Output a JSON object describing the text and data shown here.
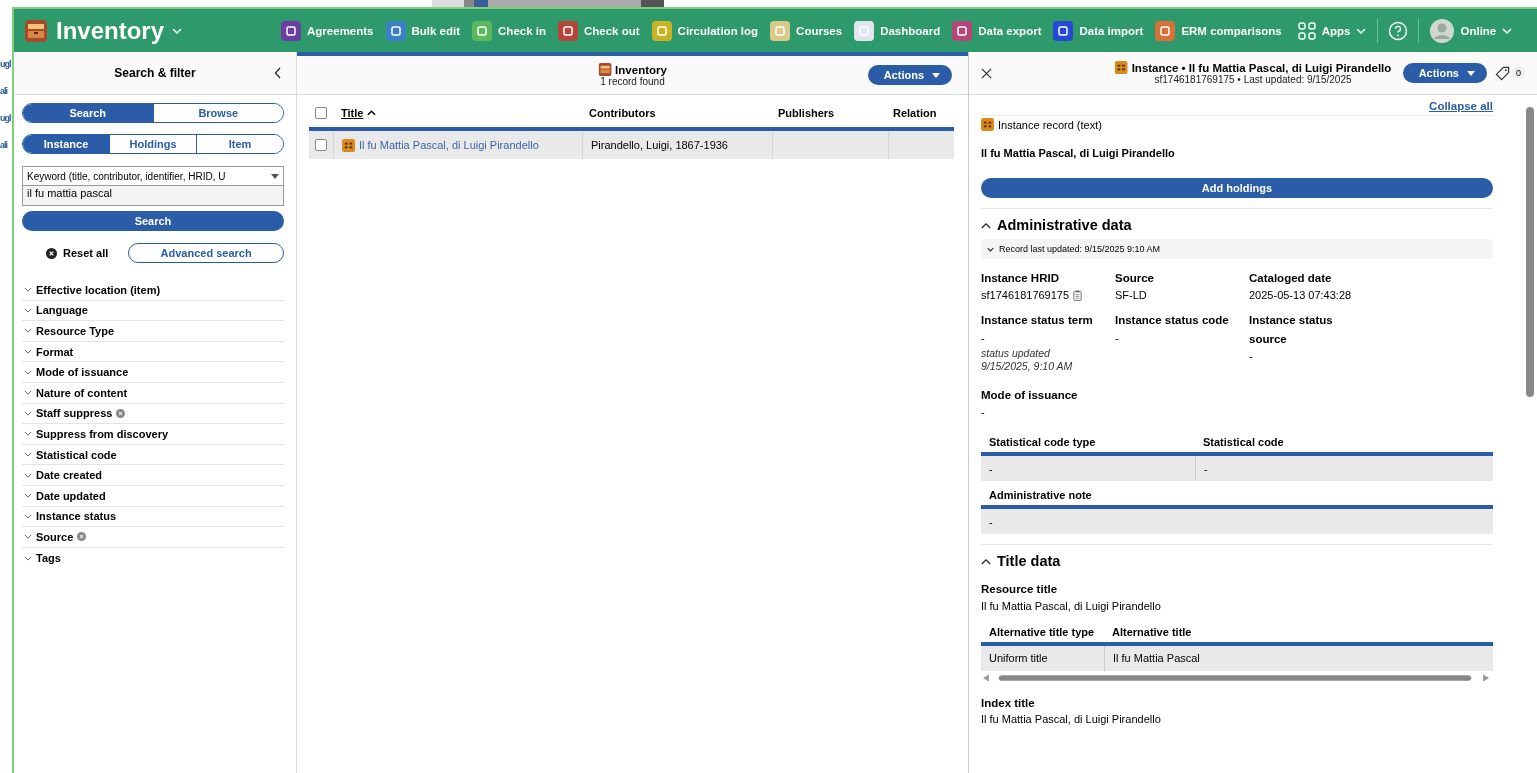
{
  "background_window": {
    "fragments": [
      "ugl",
      "ali",
      "ugl",
      "ali"
    ]
  },
  "app_header": {
    "app_name": "Inventory",
    "apps": [
      {
        "label": "Agreements",
        "color": "#6b3fa0"
      },
      {
        "label": "Bulk edit",
        "color": "#3b7fc4"
      },
      {
        "label": "Check in",
        "color": "#5cb85c"
      },
      {
        "label": "Check out",
        "color": "#b5473a"
      },
      {
        "label": "Circulation log",
        "color": "#c9b325"
      },
      {
        "label": "Courses",
        "color": "#d9c98a"
      },
      {
        "label": "Dashboard",
        "color": "#dfe6ee"
      },
      {
        "label": "Data export",
        "color": "#b8457a"
      },
      {
        "label": "Data import",
        "color": "#2748d6"
      },
      {
        "label": "ERM comparisons",
        "color": "#d9703a"
      }
    ],
    "apps_menu": "Apps",
    "user_status": "Online"
  },
  "filter_pane": {
    "title": "Search & filter",
    "segments": [
      {
        "label": "Search",
        "selected": true
      },
      {
        "label": "Browse",
        "selected": false
      }
    ],
    "record_types": [
      {
        "label": "Instance",
        "selected": true
      },
      {
        "label": "Holdings",
        "selected": false
      },
      {
        "label": "Item",
        "selected": false
      }
    ],
    "search_option": "Keyword (title, contributor, identifier, HRID, U",
    "query": "il fu mattia pascal",
    "search_button": "Search",
    "reset_all": "Reset all",
    "advanced_search": "Advanced search",
    "filters": [
      {
        "label": "Effective location (item)",
        "expanded": false,
        "clearable": false
      },
      {
        "label": "Language",
        "expanded": false,
        "clearable": false
      },
      {
        "label": "Resource Type",
        "expanded": false,
        "clearable": false
      },
      {
        "label": "Format",
        "expanded": false,
        "clearable": false
      },
      {
        "label": "Mode of issuance",
        "expanded": false,
        "clearable": false
      },
      {
        "label": "Nature of content",
        "expanded": false,
        "clearable": false
      },
      {
        "label": "Staff suppress",
        "expanded": false,
        "clearable": true
      },
      {
        "label": "Suppress from discovery",
        "expanded": false,
        "clearable": false
      },
      {
        "label": "Statistical code",
        "expanded": false,
        "clearable": false
      },
      {
        "label": "Date created",
        "expanded": false,
        "clearable": false
      },
      {
        "label": "Date updated",
        "expanded": false,
        "clearable": false
      },
      {
        "label": "Instance status",
        "expanded": false,
        "clearable": false
      },
      {
        "label": "Source",
        "expanded": false,
        "clearable": true
      },
      {
        "label": "Tags",
        "expanded": false,
        "clearable": false
      }
    ]
  },
  "results_pane": {
    "title": "Inventory",
    "subtitle": "1 record found",
    "actions": "Actions",
    "select_all": {
      "checked": false
    },
    "columns": [
      {
        "label": "Title",
        "sorted": true
      },
      {
        "label": "Contributors",
        "sorted": false
      },
      {
        "label": "Publishers",
        "sorted": false
      },
      {
        "label": "Relation",
        "sorted": false
      }
    ],
    "rows": [
      {
        "selected": true,
        "checked": false,
        "title": "Il fu Mattia Pascal, di Luigi Pirandello",
        "contributors": "Pirandello, Luigi, 1867-1936"
      }
    ]
  },
  "detail_pane": {
    "title": "Instance • Il fu Mattia Pascal, di Luigi Pirandello",
    "subtitle": "sf1746181769175 • Last updated: 9/15/2025",
    "actions": "Actions",
    "tag_count": "0",
    "collapse_all": "Collapse all",
    "record_type": "Instance record (text)",
    "record_title": "Il fu Mattia Pascal, di Luigi Pirandello",
    "add_holdings": "Add holdings",
    "administrative": {
      "heading": "Administrative data",
      "expanded": true,
      "record_last_updated": {
        "label": "Record last updated: 9/15/2025 9:10 AM",
        "expanded": false
      },
      "fields": [
        {
          "label": "Instance HRID",
          "value": "sf1746181769175",
          "copyable": true
        },
        {
          "label": "Source",
          "value": "SF-LD",
          "copyable": false
        },
        {
          "label": "Cataloged date",
          "value": "2025-05-13 07:43:28",
          "copyable": false
        },
        {
          "label": "Instance status term",
          "value": "-",
          "note": "status updated 9/15/2025, 9:10 AM",
          "copyable": false
        },
        {
          "label": "Instance status code",
          "value": "-",
          "copyable": false
        },
        {
          "label": "Instance status source",
          "value": "-",
          "copyable": false
        }
      ],
      "mode_of_issuance": {
        "label": "Mode of issuance",
        "value": "-"
      },
      "statistical_codes": {
        "columns": [
          "Statistical code type",
          "Statistical code"
        ],
        "rows": [
          [
            "-",
            "-"
          ]
        ]
      },
      "administrative_note": {
        "columns": [
          "Administrative note"
        ],
        "rows": [
          [
            "-"
          ]
        ]
      }
    },
    "title_data": {
      "heading": "Title data",
      "expanded": true,
      "resource_title": {
        "label": "Resource title",
        "value": "Il fu Mattia Pascal, di Luigi Pirandello"
      },
      "alternative_titles": {
        "columns": [
          "Alternative title type",
          "Alternative title"
        ],
        "rows": [
          [
            "Uniform title",
            "Il fu Mattia Pascal"
          ]
        ]
      },
      "index_title": {
        "label": "Index title",
        "value": "Il fu Mattia Pascal, di Luigi Pirandello"
      }
    }
  }
}
